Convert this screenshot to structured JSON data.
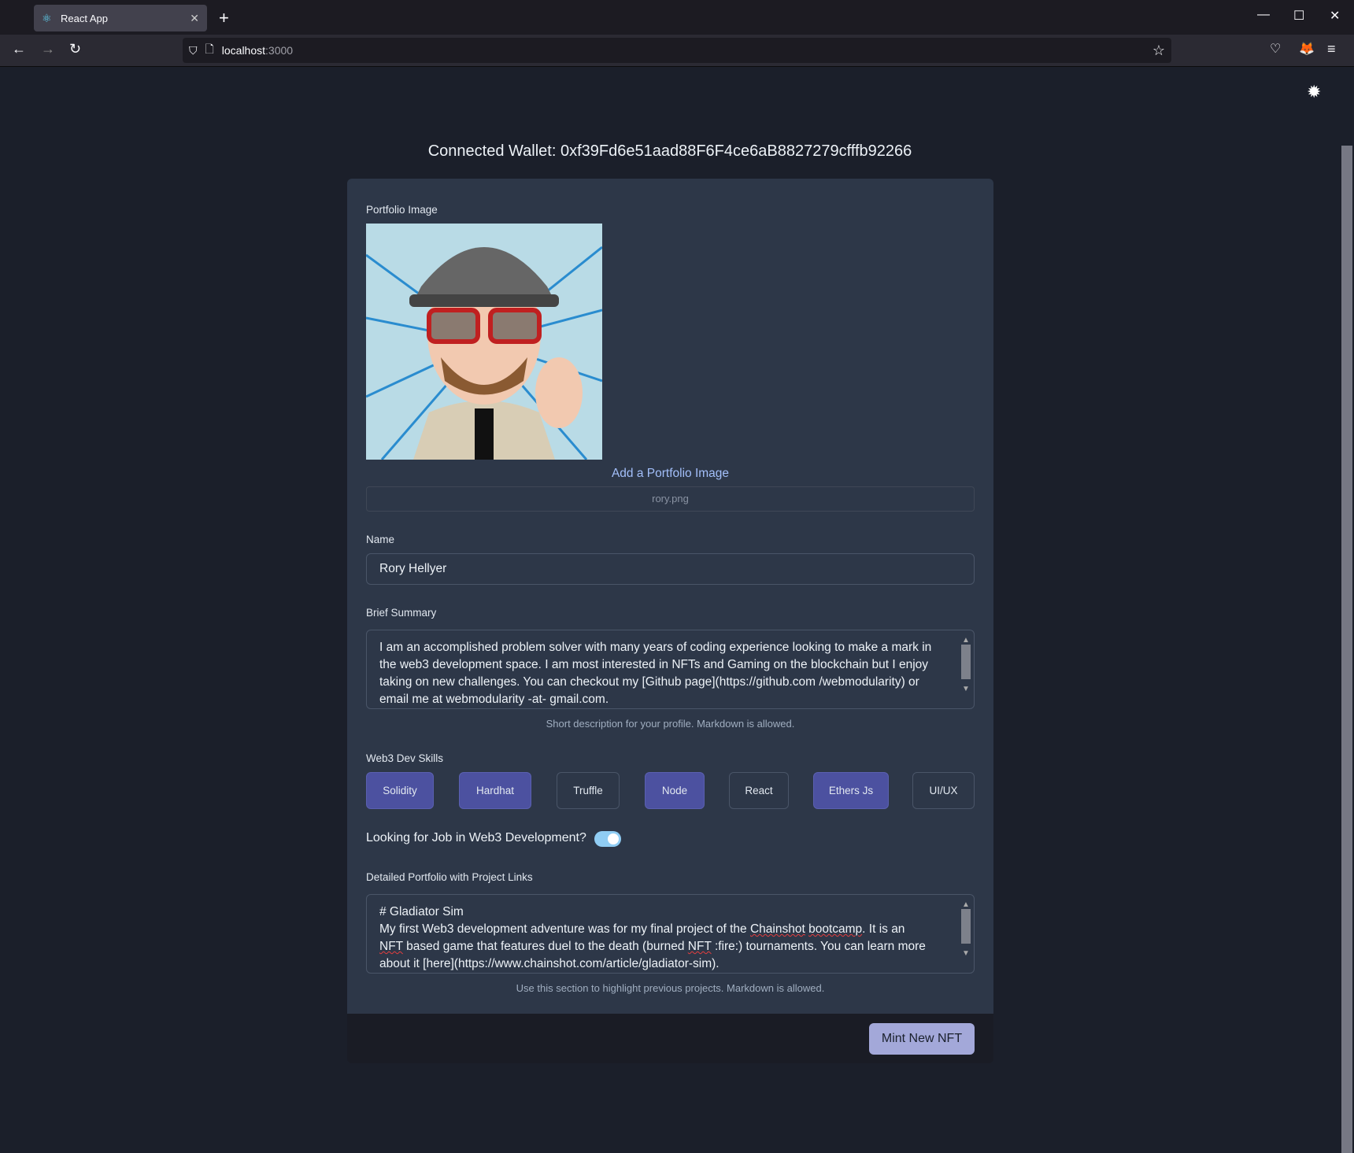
{
  "browser": {
    "tab_title": "React App",
    "url_host": "localhost",
    "url_port": ":3000"
  },
  "page": {
    "wallet": "Connected Wallet: 0xf39Fd6e51aad88F6F4ce6aB8827279cfffb92266",
    "portfolio_image_label": "Portfolio Image",
    "add_image_label": "Add a Portfolio Image",
    "file_name": "rory.png",
    "name_label": "Name",
    "name_value": "Rory Hellyer",
    "summary_label": "Brief Summary",
    "summary_value": "I am an accomplished problem solver with many years of coding experience looking to make a mark in the web3 development space. I am most interested in NFTs and Gaming on the blockchain but I enjoy taking on new challenges. You can checkout my [Github page](https://github.com /webmodularity) or email me at webmodularity -at- gmail.com.",
    "summary_help": "Short description for your profile. Markdown is allowed.",
    "skills_label": "Web3 Dev Skills",
    "skills": [
      {
        "label": "Solidity",
        "selected": true
      },
      {
        "label": "Hardhat",
        "selected": true
      },
      {
        "label": "Truffle",
        "selected": false
      },
      {
        "label": "Node",
        "selected": true
      },
      {
        "label": "React",
        "selected": false
      },
      {
        "label": "Ethers Js",
        "selected": true
      },
      {
        "label": "UI/UX",
        "selected": false
      }
    ],
    "job_label": "Looking for Job in Web3 Development?",
    "job_toggle": true,
    "portfolio_label": "Detailed Portfolio with Project Links",
    "portfolio_lines": {
      "l1": "# Gladiator Sim",
      "l2a": "My first Web3 development adventure was for my final project of the ",
      "l2b": "Chainshot",
      "l2c": " ",
      "l2d": "bootcamp",
      "l2e": ". It is an",
      "l3a": "NFT",
      "l3b": " based game that features duel to the death (burned ",
      "l3c": "NFT",
      "l3d": " :fire:) tournaments. You can learn more",
      "l4": "about it [here](https://www.chainshot.com/article/gladiator-sim)."
    },
    "portfolio_help": "Use this section to highlight previous projects. Markdown is allowed.",
    "mint_label": "Mint New NFT"
  },
  "colors": {
    "accent": "#4c51a0",
    "button": "#a3a8d9",
    "card": "#2d3748",
    "background": "#1b1f2a"
  }
}
